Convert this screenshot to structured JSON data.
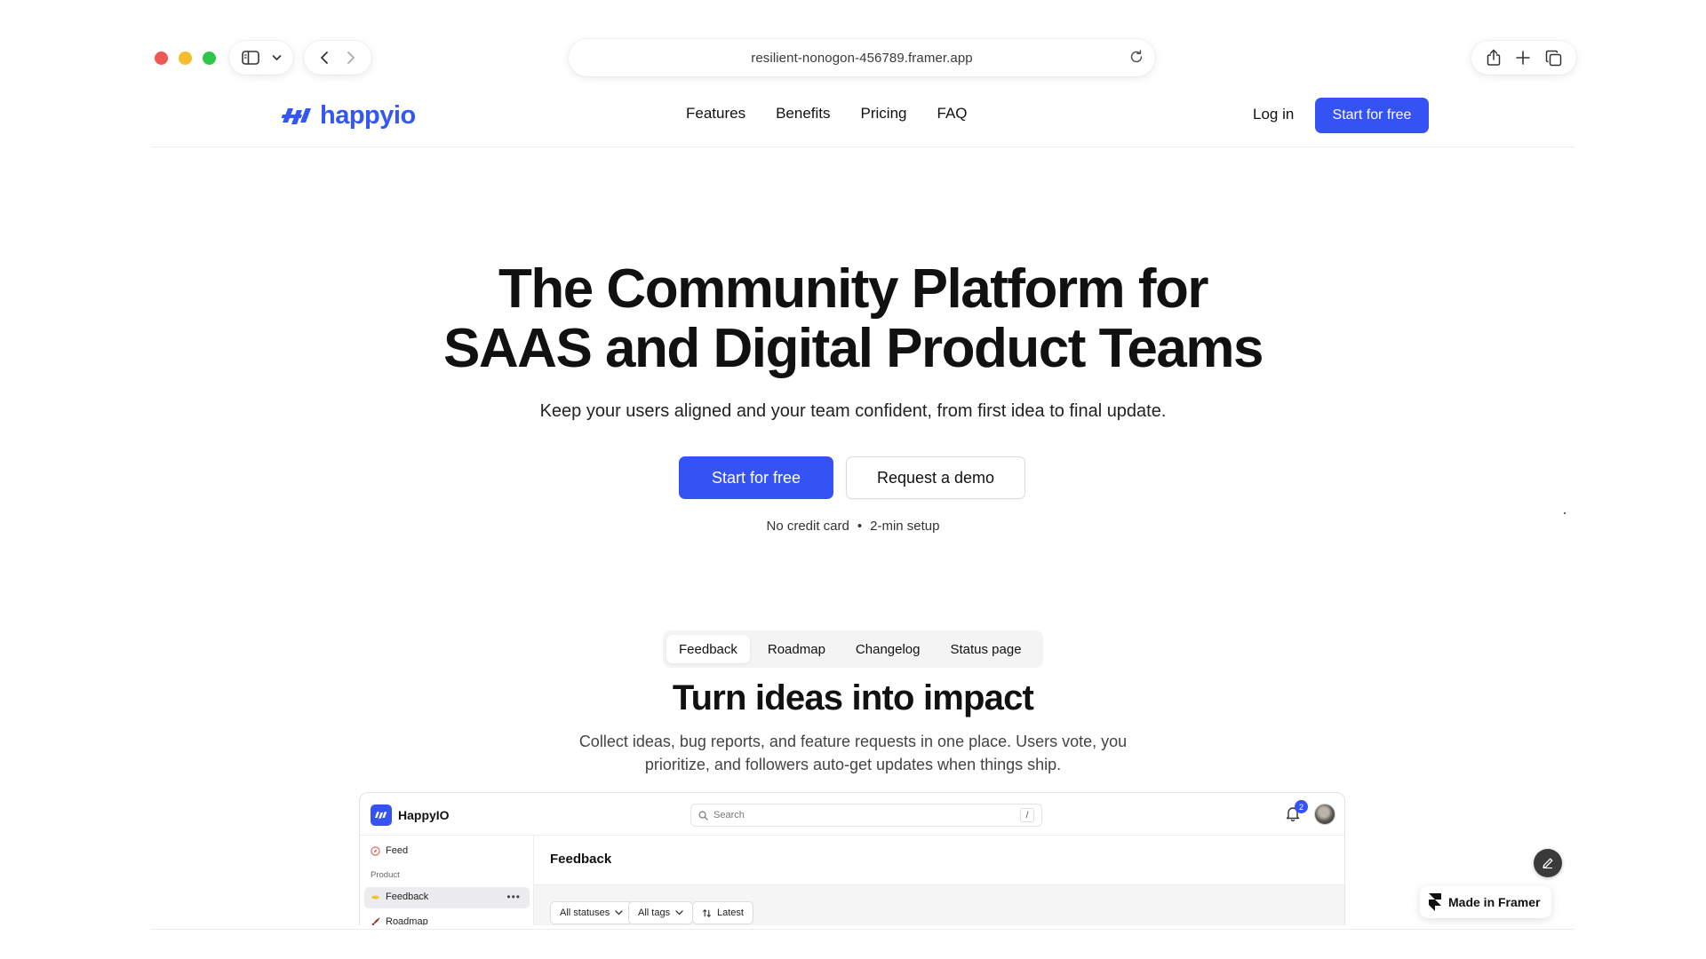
{
  "browser": {
    "url": "resilient-nonogon-456789.framer.app",
    "icons": [
      "sidebar-icon",
      "chevron-down-icon",
      "back-icon",
      "forward-icon",
      "reload-icon",
      "share-icon",
      "plus-icon",
      "tabs-icon"
    ]
  },
  "header": {
    "logo_text": "happyio",
    "nav": [
      "Features",
      "Benefits",
      "Pricing",
      "FAQ"
    ],
    "login": "Log in",
    "cta": "Start for free"
  },
  "hero": {
    "title_line1": "The Community Platform for",
    "title_line2": "SAAS and Digital Product Teams",
    "subtitle": "Keep your users aligned and your team confident, from first idea to final update.",
    "primary_cta": "Start for free",
    "secondary_cta": "Request a demo",
    "note_left": "No credit card",
    "note_sep": "•",
    "note_right": "2-min setup"
  },
  "tabs": {
    "items": [
      "Feedback",
      "Roadmap",
      "Changelog",
      "Status page"
    ],
    "active": "Feedback"
  },
  "section": {
    "title": "Turn ideas into impact",
    "description": "Collect ideas, bug reports, and feature requests in one place. Users vote, you prioritize, and followers auto-get updates when things ship."
  },
  "preview": {
    "brand": "HappyIO",
    "search_placeholder": "Search",
    "search_shortcut": "/",
    "notification_count": "2",
    "sidebar": {
      "feed": "Feed",
      "product_heading": "Product",
      "feedback": "Feedback",
      "more": "•••",
      "roadmap": "Roadmap"
    },
    "main_title": "Feedback",
    "filters": {
      "statuses": "All statuses",
      "tags": "All tags",
      "sort": "Latest"
    }
  },
  "floating": {
    "framer_badge": "Made in Framer"
  },
  "colors": {
    "accent": "#3553f4",
    "logo": "#3456f5",
    "text": "#111111"
  }
}
